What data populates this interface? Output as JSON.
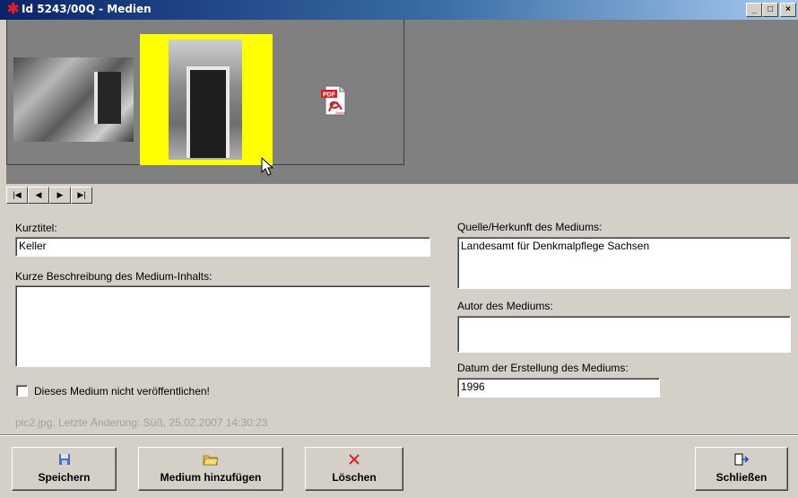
{
  "window": {
    "title": "Id 5243/00Q - Medien",
    "minimize": "_",
    "maximize": "□",
    "close": "×"
  },
  "nav": {
    "first": "|◀",
    "prev": "◀",
    "next": "▶",
    "last": "▶|"
  },
  "thumbnails": {
    "pdf_label": "PDF",
    "pdf_brand": "Adobe"
  },
  "form": {
    "kurztitel_label": "Kurztitel:",
    "kurztitel_value": "Keller",
    "beschreibung_label": "Kurze Beschreibung des Medium-Inhalts:",
    "beschreibung_value": "",
    "checkbox_label": "Dieses Medium nicht veröffentlichen!",
    "quelle_label": "Quelle/Herkunft des Mediums:",
    "quelle_value": "Landesamt für Denkmalpflege Sachsen",
    "autor_label": "Autor des Mediums:",
    "autor_value": "",
    "datum_label": "Datum der Erstellung des Mediums:",
    "datum_value": "1996",
    "status": "pic2.jpg, Letzte Änderung: Süß, 25.02.2007 14:30:23"
  },
  "buttons": {
    "save": "Speichern",
    "add": "Medium hinzufügen",
    "delete": "Löschen",
    "close": "Schließen"
  },
  "icons": {
    "save": "floppy-disk-icon",
    "add": "folder-open-icon",
    "delete": "red-x-icon",
    "close": "exit-door-icon",
    "app": "red-star-icon"
  }
}
